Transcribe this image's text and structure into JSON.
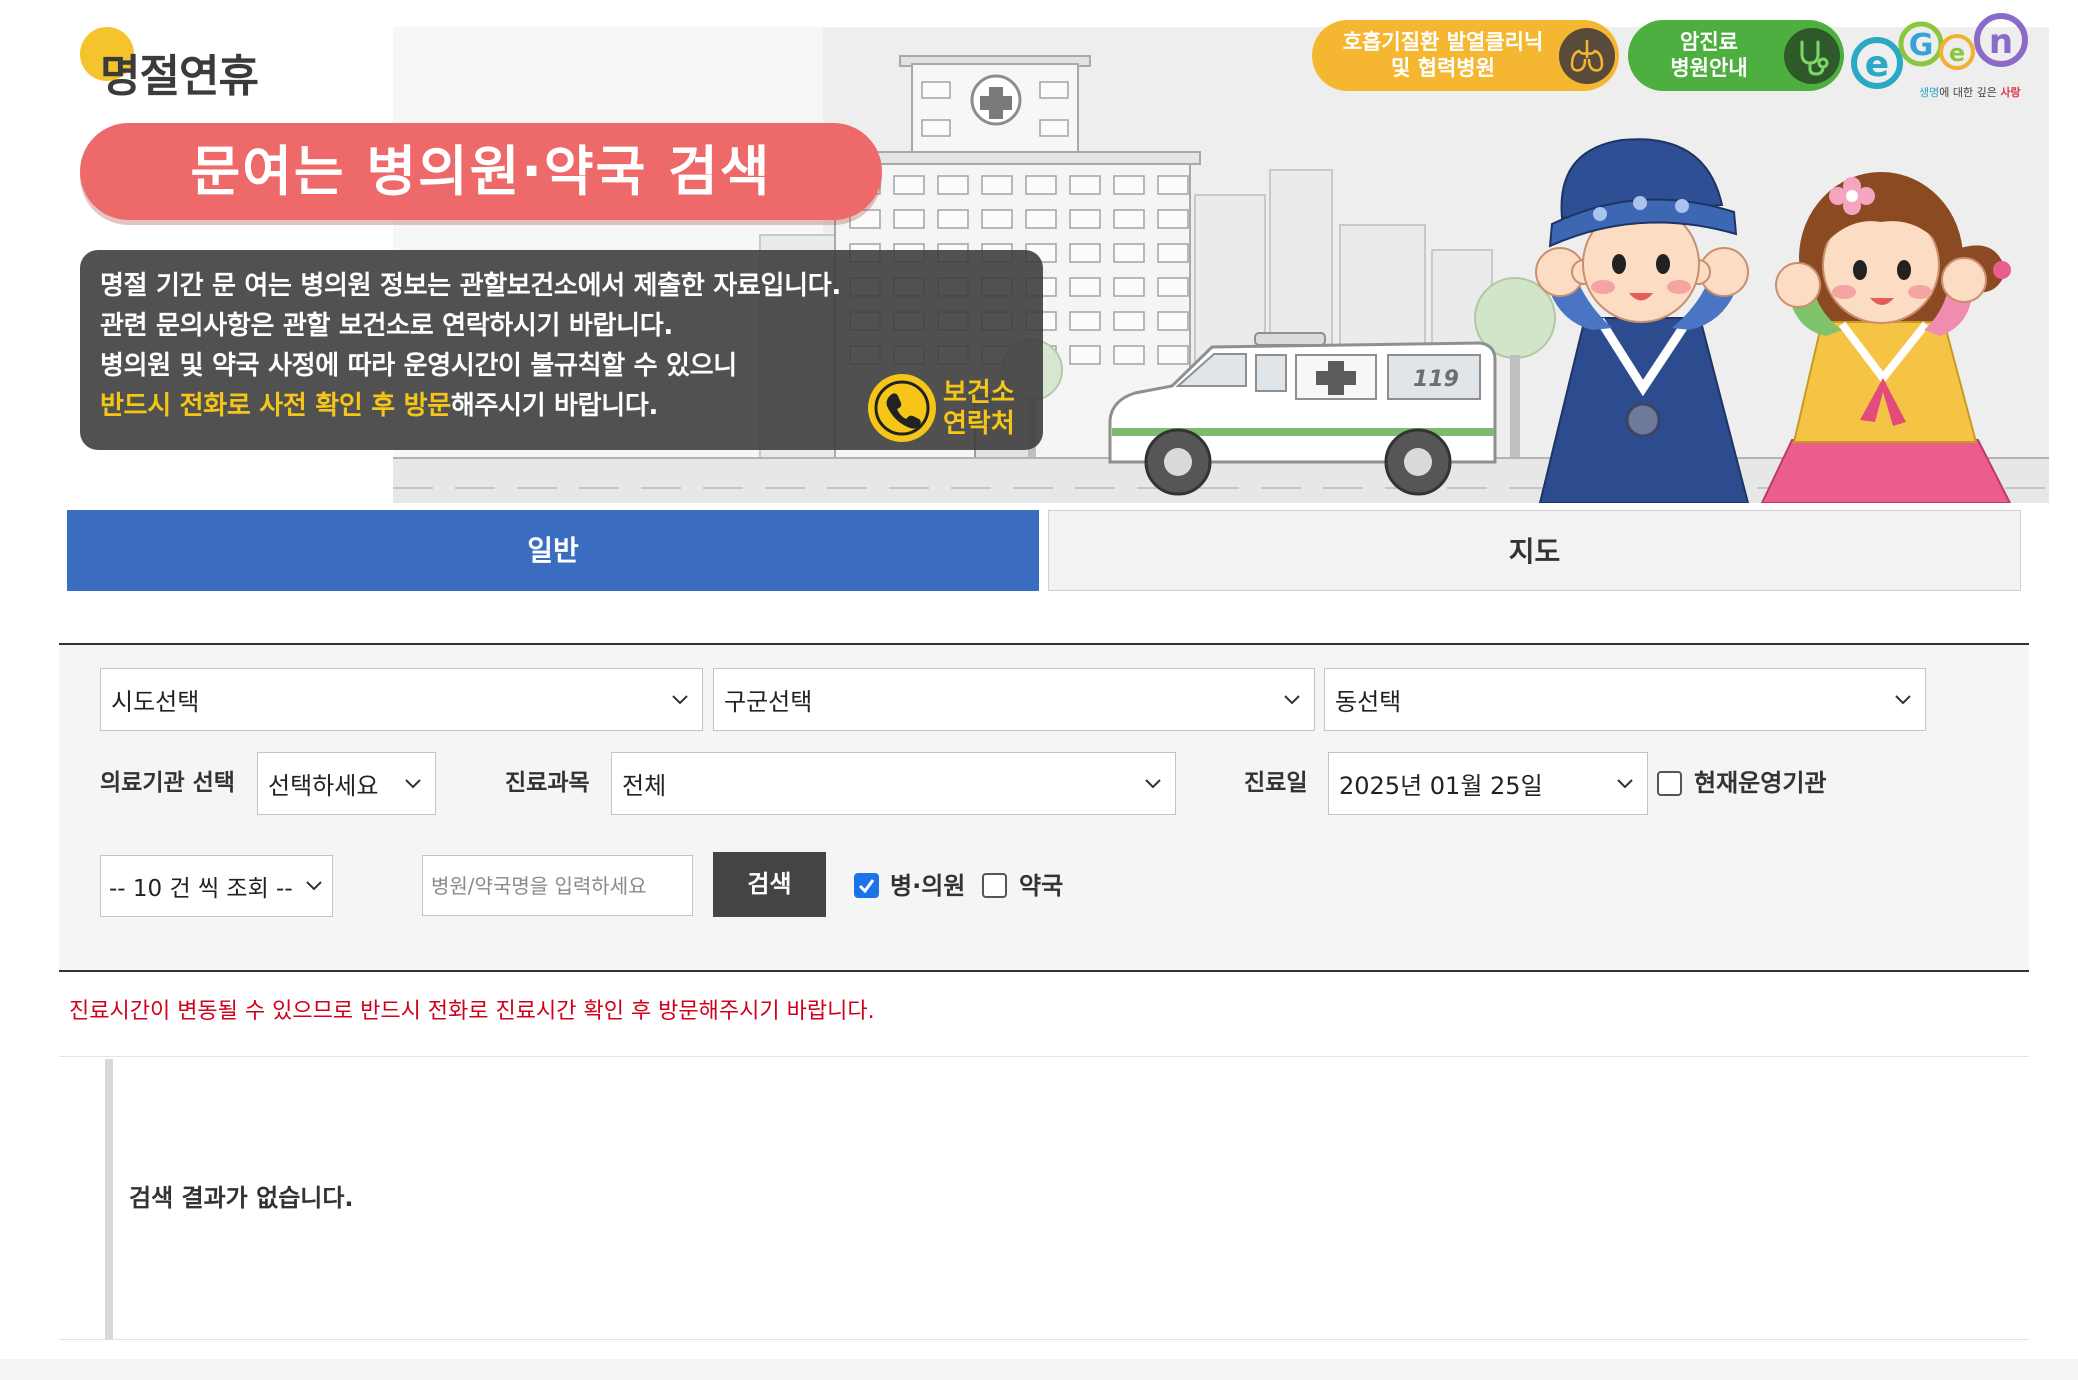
{
  "header": {
    "logo_text": "명절연휴",
    "title": "문여는 병의원·약국 검색",
    "notice_lines": [
      "명절 기간 문 여는 병의원 정보는 관할보건소에서 제출한 자료입니다.",
      "관련 문의사항은 관할 보건소로 연락하시기 바랍니다.",
      "병의원 및 약국 사정에 따라 운영시간이 불규칙할 수 있으니"
    ],
    "notice_highlight": "반드시 전화로 사전 확인 후 방문",
    "notice_tail": "해주시기 바랍니다.",
    "contact_button": {
      "line1": "보건소",
      "line2": "연락처",
      "icon": "phone-icon"
    },
    "quick_links": [
      {
        "line1": "호흡기질환 발열클리닉",
        "line2": "및 협력병원",
        "icon": "lungs-icon",
        "color": "#f5b731"
      },
      {
        "line1": "암진료",
        "line2": "병원안내",
        "icon": "stethoscope-icon",
        "color": "#4caf3f"
      }
    ],
    "egen_logo": {
      "letters": [
        "e",
        "G",
        "e",
        "n"
      ],
      "tagline": [
        "생명",
        "에 대한 깊은 ",
        "사랑"
      ]
    },
    "ambulance_text": "119"
  },
  "tabs": [
    {
      "label": "일반",
      "active": true
    },
    {
      "label": "지도",
      "active": false
    }
  ],
  "search": {
    "sido": "시도선택",
    "gugun": "구군선택",
    "dong": "동선택",
    "institution_label": "의료기관 선택",
    "institution_value": "선택하세요",
    "department_label": "진료과목",
    "department_value": "전체",
    "date_label": "진료일",
    "date_value": "2025년 01월 25일",
    "open_now_label": "현재운영기관",
    "open_now_checked": false,
    "page_size": "-- 10 건 씩 조회 --",
    "keyword_placeholder": "병원/약국명을 입력하세요",
    "keyword_value": "",
    "search_button": "검색",
    "hospital_label": "병·의원",
    "hospital_checked": true,
    "pharmacy_label": "약국",
    "pharmacy_checked": false
  },
  "notice": "진료시간이 변동될 수 있으므로 반드시 전화로 진료시간 확인 후 방문해주시기 바랍니다.",
  "results": {
    "empty_message": "검색 결과가 없습니다."
  },
  "colors": {
    "tab_active": "#3a6cbf",
    "notice_red": "#d0021b",
    "title_pill": "#ee6a6a",
    "highlight_yellow": "#f5c518",
    "search_button": "#444444",
    "checkbox_checked": "#1a73e8"
  }
}
